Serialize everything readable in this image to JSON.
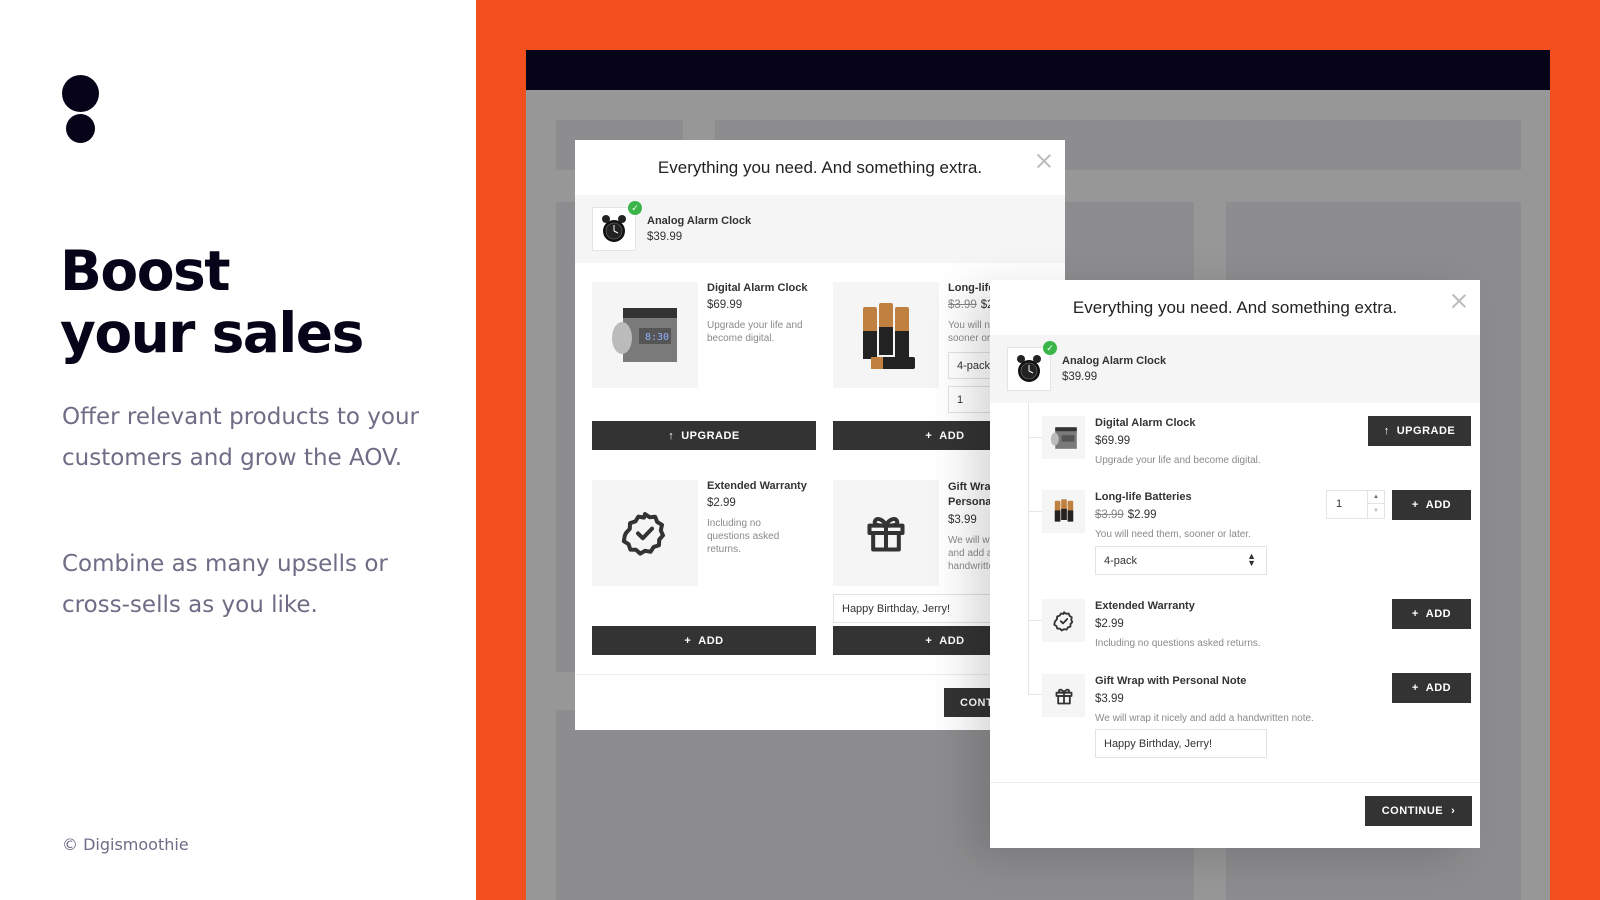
{
  "marketing": {
    "headline_line1": "Boost",
    "headline_line2": "your sales",
    "paragraph1": "Offer relevant products to your customers and grow the AOV.",
    "paragraph2": "Combine as many upsells or cross-sells as you like.",
    "copyright": "© Digismoothie"
  },
  "colors": {
    "brand_orange": "#f24f1e",
    "brand_dark": "#070318",
    "button_dark": "#333333",
    "check_green": "#3bb54a"
  },
  "modal": {
    "title": "Everything you need. And something extra.",
    "cart_item": {
      "name": "Analog Alarm Clock",
      "price": "$39.99",
      "icon": "alarm-clock-icon"
    },
    "products": [
      {
        "name": "Digital Alarm Clock",
        "price": "$69.99",
        "description": "Upgrade your life and become digital.",
        "action": "UPGRADE",
        "action_icon": "arrow-up-icon",
        "icon": "digital-clock-image"
      },
      {
        "name": "Long-life Batteries",
        "name_truncated": "Long-life B",
        "old_price": "$3.99",
        "price": "$2.99",
        "price_truncated": "$2.",
        "description": "You will need them, sooner or later.",
        "description_truncated_1": "You will nee",
        "description_truncated_2": "sooner or la",
        "variant_selected": "4-pack",
        "quantity": "1",
        "action": "ADD",
        "action_icon": "plus-icon",
        "icon": "batteries-image"
      },
      {
        "name": "Extended Warranty",
        "price": "$2.99",
        "description": "Including no questions asked returns.",
        "action": "ADD",
        "action_icon": "plus-icon",
        "icon": "badge-check-icon"
      },
      {
        "name": "Gift Wrap with Personal Note",
        "name_truncated_1": "Gift Wrap",
        "name_truncated_2": "Personal N",
        "price": "$3.99",
        "description": "We will wrap it nicely and add a handwritten note.",
        "description_truncated_1": "We will wr",
        "description_truncated_2": "and add a",
        "description_truncated_3": "handwritte",
        "note_value": "Happy Birthday, Jerry!",
        "action": "ADD",
        "action_icon": "plus-icon",
        "icon": "gift-icon"
      }
    ],
    "continue_label": "CONTINUE",
    "continue_truncated": "CONT"
  }
}
